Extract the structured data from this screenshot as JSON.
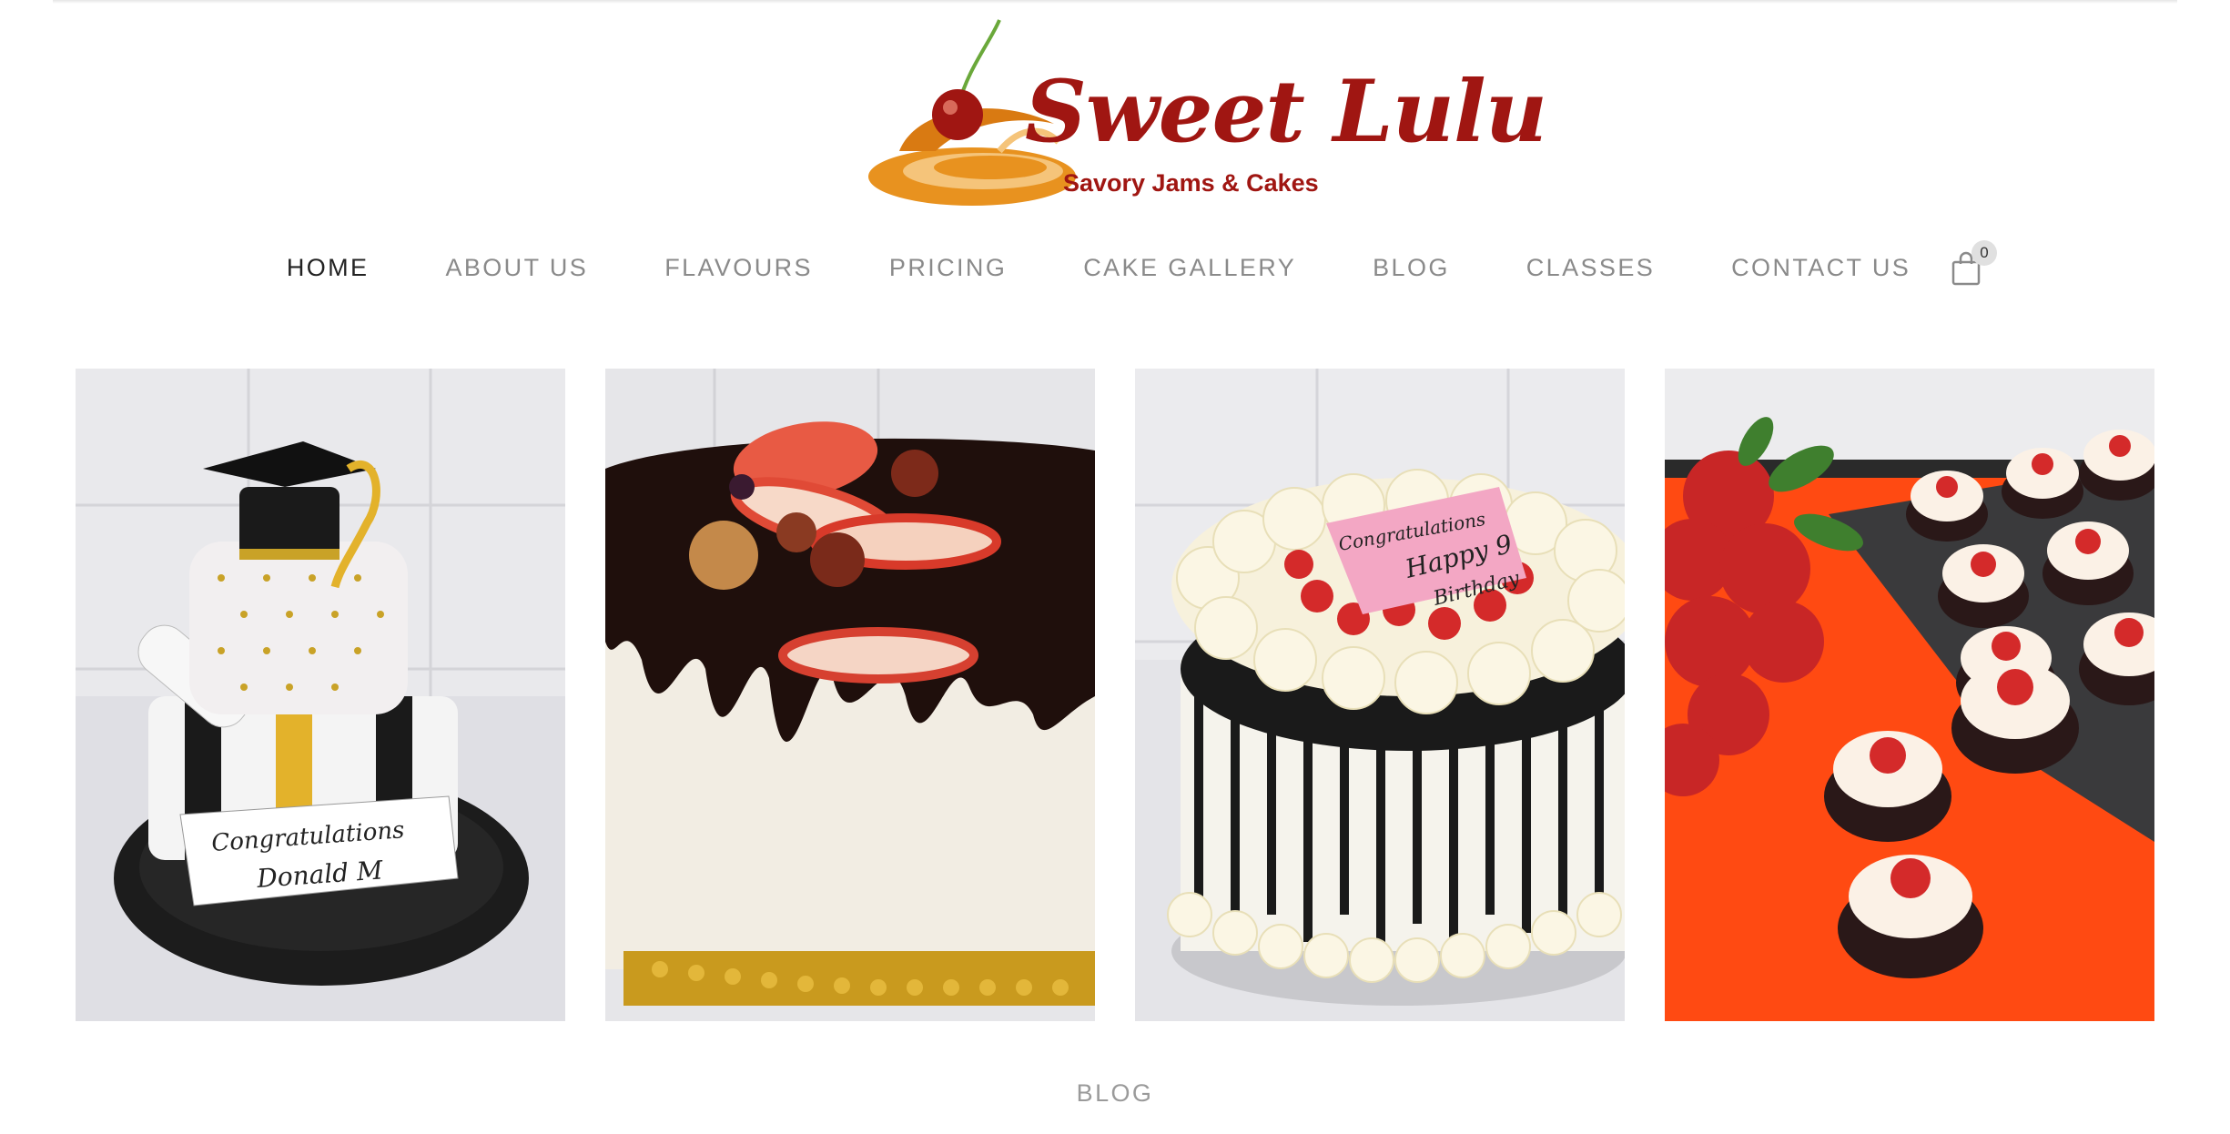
{
  "brand": {
    "name": "Sweet Lulu",
    "tagline": "Savory Jams & Cakes",
    "primary_color": "#a01612",
    "accent_color": "#e8921f"
  },
  "nav": {
    "items": [
      {
        "label": "HOME",
        "active": true
      },
      {
        "label": "ABOUT US",
        "active": false
      },
      {
        "label": "FLAVOURS",
        "active": false
      },
      {
        "label": "PRICING",
        "active": false
      },
      {
        "label": "CAKE GALLERY",
        "active": false
      },
      {
        "label": "BLOG",
        "active": false
      },
      {
        "label": "CLASSES",
        "active": false
      },
      {
        "label": "CONTACT US",
        "active": false
      }
    ],
    "cart": {
      "icon": "shopping-bag-icon",
      "count": "0"
    }
  },
  "gallery": {
    "tiles": [
      {
        "subject": "graduation-cake-photo",
        "cake_text": [
          "Congratulations",
          "Donald M"
        ]
      },
      {
        "subject": "chocolate-drip-fruit-cake-photo"
      },
      {
        "subject": "strawberry-cream-birthday-cake-photo",
        "cake_text": [
          "Congratulations",
          "Happy 9",
          "Birthday"
        ]
      },
      {
        "subject": "strawberry-cupcakes-photo"
      }
    ]
  },
  "section_label": "BLOG"
}
